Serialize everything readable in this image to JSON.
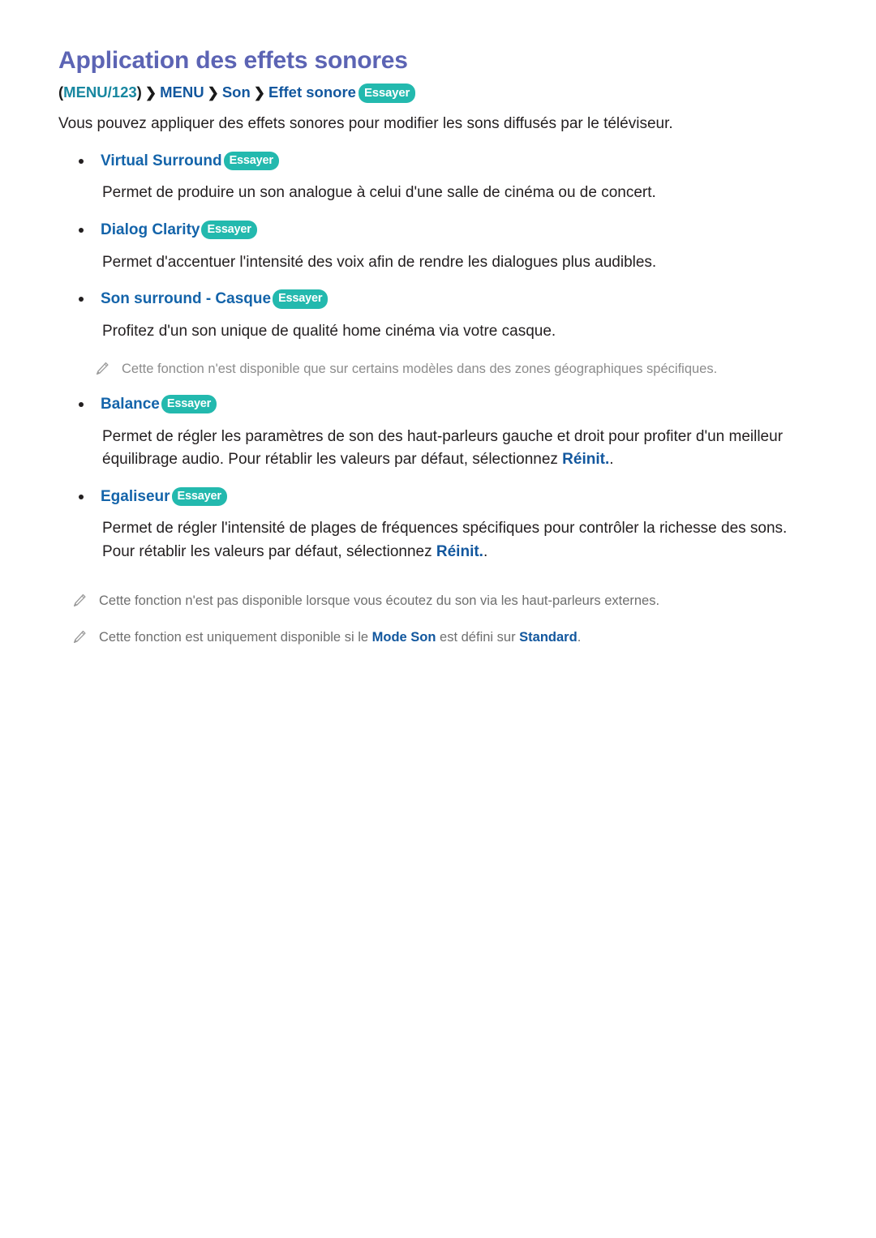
{
  "document": {
    "title": "Application des effets sonores",
    "breadcrumb": {
      "open_paren": "(",
      "menu123": "MENU/123",
      "close_paren": ")",
      "separator": "❯",
      "menu": "MENU",
      "son": "Son",
      "effet_sonore": "Effet sonore",
      "try_label": "Essayer"
    },
    "intro": "Vous pouvez appliquer des effets sonores pour modifier les sons diffusés par le téléviseur.",
    "items": [
      {
        "heading": "Virtual Surround",
        "try_label": "Essayer",
        "description": "Permet de produire un son analogue à celui d'une salle de cinéma ou de concert."
      },
      {
        "heading": "Dialog Clarity",
        "try_label": "Essayer",
        "description": "Permet d'accentuer l'intensité des voix afin de rendre les dialogues plus audibles."
      },
      {
        "heading": "Son surround - Casque",
        "try_label": "Essayer",
        "description": "Profitez d'un son unique de qualité home cinéma via votre casque.",
        "note": "Cette fonction n'est disponible que sur certains modèles dans des zones géographiques spécifiques."
      },
      {
        "heading": "Balance",
        "try_label": "Essayer",
        "desc_part1": "Permet de régler les paramètres de son des haut-parleurs gauche et droit pour profiter d'un meilleur équilibrage audio. Pour rétablir les valeurs par défaut, sélectionnez ",
        "desc_highlight": "Réinit.",
        "desc_part2": "."
      },
      {
        "heading": "Egaliseur",
        "try_label": "Essayer",
        "desc_part1": "Permet de régler l'intensité de plages de fréquences spécifiques pour contrôler la richesse des sons. Pour rétablir les valeurs par défaut, sélectionnez ",
        "desc_highlight": "Réinit.",
        "desc_part2": "."
      }
    ],
    "footer_notes": [
      {
        "text": "Cette fonction n'est pas disponible lorsque vous écoutez du son via les haut-parleurs externes."
      },
      {
        "part1": "Cette fonction est uniquement disponible si le ",
        "highlight1": "Mode Son",
        "part2": " est défini sur ",
        "highlight2": "Standard",
        "part3": "."
      }
    ],
    "icons": {
      "note": "pencil-icon",
      "separator": "chevron-right-icon"
    },
    "colors": {
      "title": "#5c64b4",
      "heading": "#1464aa",
      "link": "#12579e",
      "teal": "#1887a0",
      "pill": "#23b9ae",
      "body": "#231f20",
      "note_gray": "#8c8c8c"
    }
  }
}
